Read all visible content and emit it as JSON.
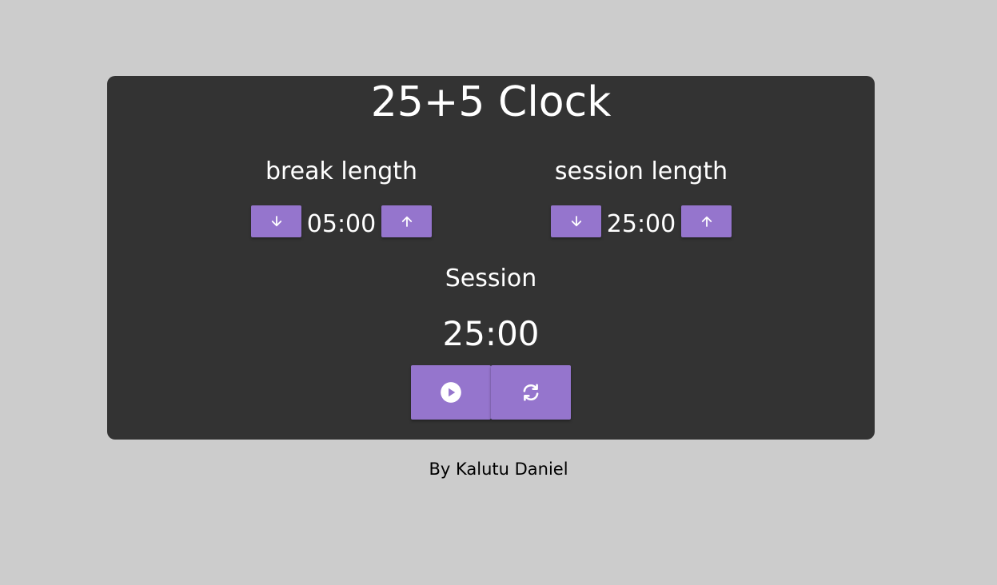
{
  "app": {
    "title": "25+5 Clock"
  },
  "break_control": {
    "label": "break length",
    "value": "05:00",
    "decrement_icon": "arrow-down-icon",
    "increment_icon": "arrow-up-icon"
  },
  "session_control": {
    "label": "session length",
    "value": "25:00",
    "decrement_icon": "arrow-down-icon",
    "increment_icon": "arrow-up-icon"
  },
  "timer": {
    "label": "Session",
    "time_left": "25:00",
    "play_icon": "play-circle-icon",
    "reset_icon": "refresh-icon"
  },
  "footer": {
    "credit": "By Kalutu Daniel"
  },
  "colors": {
    "background": "#cccccc",
    "card": "#333333",
    "accent": "#9575cd",
    "text": "#ffffff"
  }
}
